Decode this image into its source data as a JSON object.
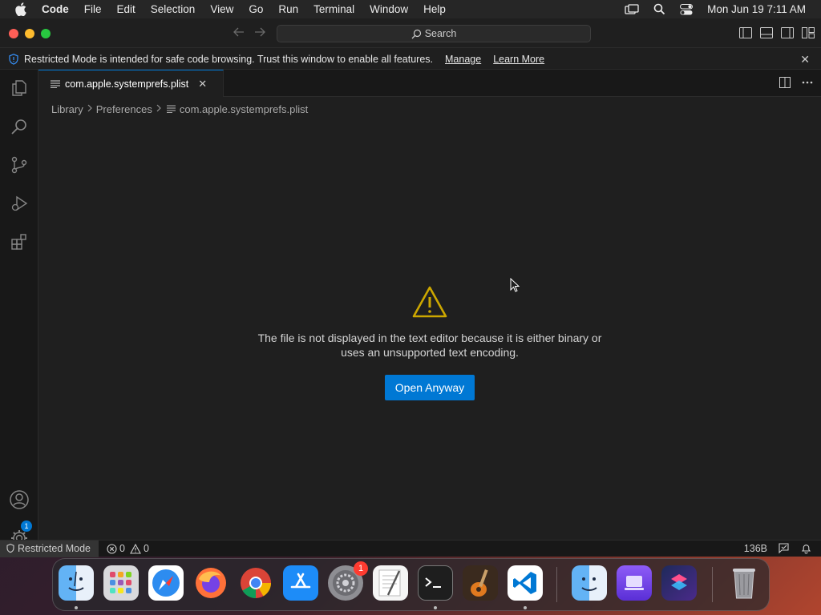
{
  "menubar": {
    "app_name": "Code",
    "items": [
      "File",
      "Edit",
      "Selection",
      "View",
      "Go",
      "Run",
      "Terminal",
      "Window",
      "Help"
    ],
    "clock": "Mon Jun 19  7:11 AM"
  },
  "titlebar": {
    "search_label": "Search"
  },
  "banner": {
    "text": "Restricted Mode is intended for safe code browsing. Trust this window to enable all features.",
    "manage_label": "Manage",
    "learn_more_label": "Learn More"
  },
  "activitybar": {
    "accounts_badge": "1"
  },
  "tab": {
    "label": "com.apple.systemprefs.plist"
  },
  "breadcrumb": {
    "items": [
      "Library",
      "Preferences",
      "com.apple.systemprefs.plist"
    ]
  },
  "editor_message": {
    "line1": "The file is not displayed in the text editor because it is either binary or",
    "line2": "uses an unsupported text encoding.",
    "button_label": "Open Anyway"
  },
  "statusbar": {
    "restricted_label": "Restricted Mode",
    "errors": "0",
    "warnings": "0",
    "file_size": "136B"
  },
  "dock": {
    "settings_badge": "1",
    "apps": [
      "Finder",
      "Launchpad",
      "Safari",
      "Firefox",
      "Chrome",
      "App Store",
      "System Settings",
      "TextEdit",
      "Terminal",
      "GarageBand",
      "Visual Studio Code",
      "Finder",
      "App",
      "Shortcuts",
      "Trash"
    ]
  },
  "colors": {
    "accent": "#0078d4",
    "warning": "#cca700",
    "editor_bg": "#1f1f1f"
  }
}
